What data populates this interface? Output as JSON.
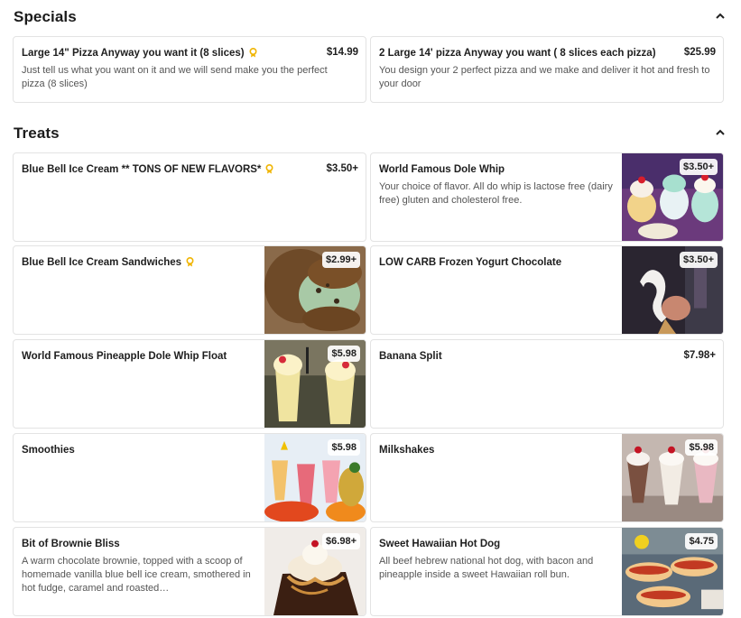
{
  "specials": {
    "title": "Specials",
    "items": [
      {
        "name": "Large 14\" Pizza Anyway you want it (8 slices)",
        "price": "$14.99",
        "description": "Just tell us what you want on it and we will send make you the perfect pizza (8 slices)",
        "badge": "award-icon"
      },
      {
        "name": "2 Large 14' pizza Anyway you want ( 8 slices each pizza)",
        "price": "$25.99",
        "description": "You design your 2 perfect pizza and we make and deliver it hot and fresh to your door"
      }
    ]
  },
  "treats": {
    "title": "Treats",
    "items": [
      {
        "name": "Blue Bell Ice Cream ** TONS OF NEW FLAVORS*",
        "price": "$3.50+",
        "badge": "award-icon"
      },
      {
        "name": "World Famous Dole Whip",
        "price": "$3.50+",
        "description": "Your choice of flavor. All do whip is lactose free (dairy free) gluten and cholesterol free.",
        "image": "ice-cream-sundae-image"
      },
      {
        "name": "Blue Bell Ice Cream Sandwiches",
        "price": "$2.99+",
        "badge": "award-icon",
        "image": "ice-cream-sandwich-image"
      },
      {
        "name": "LOW CARB Frozen Yogurt Chocolate",
        "price": "$3.50+",
        "image": "soft-serve-cone-image"
      },
      {
        "name": "World Famous Pineapple Dole Whip Float",
        "price": "$5.98",
        "image": "dole-whip-float-image"
      },
      {
        "name": "Banana Split",
        "price": "$7.98+"
      },
      {
        "name": "Smoothies",
        "price": "$5.98",
        "image": "smoothies-image"
      },
      {
        "name": "Milkshakes",
        "price": "$5.98",
        "image": "milkshakes-image"
      },
      {
        "name": "Bit of Brownie Bliss",
        "price": "$6.98+",
        "description": "A warm chocolate brownie, topped with a scoop of homemade vanilla blue bell ice cream, smothered in hot fudge, caramel and roasted…",
        "image": "brownie-sundae-image"
      },
      {
        "name": "Sweet Hawaiian Hot Dog",
        "price": "$4.75",
        "description": "All beef hebrew national hot dog, with bacon and pineapple inside a sweet Hawaiian roll bun.",
        "image": "hot-dogs-image"
      }
    ]
  },
  "icons": {
    "collapse": "chevron-up-icon",
    "award": "award-icon"
  },
  "colors": {
    "award_badge": "#f0b400",
    "card_border": "#e3e3e3",
    "text_primary": "#1e1e1e",
    "text_secondary": "#555555"
  }
}
